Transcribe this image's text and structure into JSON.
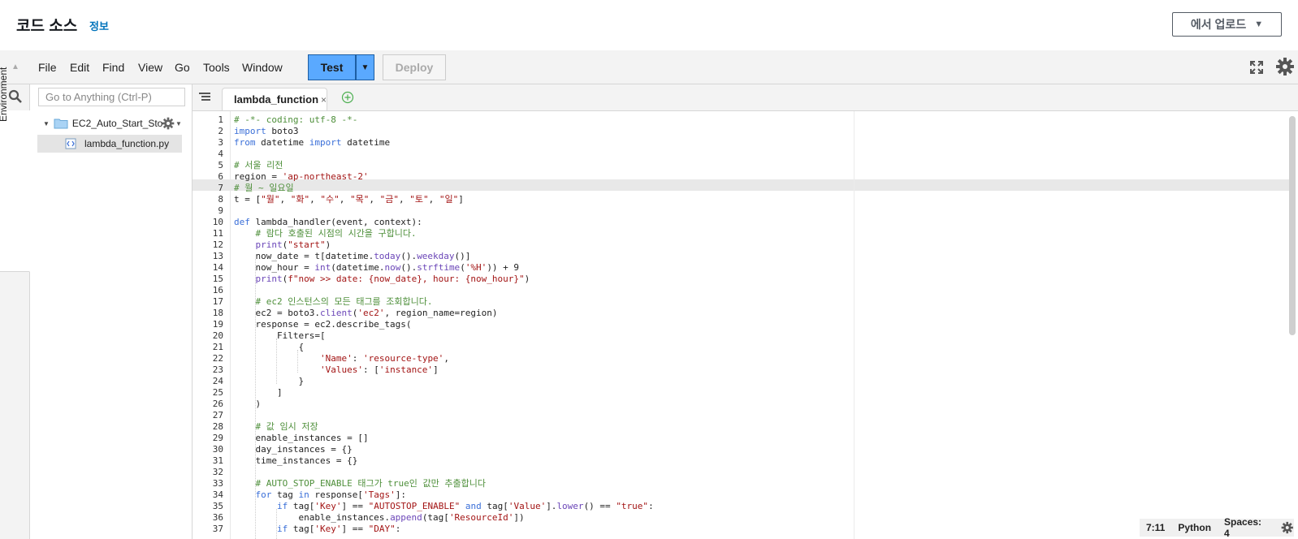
{
  "header": {
    "title": "코드 소스",
    "info_link": "정보",
    "upload_button": "에서 업로드"
  },
  "menu": {
    "items": [
      "File",
      "Edit",
      "Find",
      "View",
      "Go",
      "Tools",
      "Window"
    ],
    "test_label": "Test",
    "deploy_label": "Deploy"
  },
  "sidebar": {
    "environment_label": "Environment",
    "goto_placeholder": "Go to Anything (Ctrl-P)",
    "folder_name": "EC2_Auto_Start_Sto",
    "file_name": "lambda_function.py"
  },
  "editor": {
    "tab_label": "lambda_function",
    "tab_close": "×",
    "lines": [
      "# -*- coding: utf-8 -*-",
      "import boto3",
      "from datetime import datetime",
      "",
      "# 서울 리전",
      "region = 'ap-northeast-2'",
      "# 월 ~ 일요일",
      "t = [\"월\", \"화\", \"수\", \"목\", \"금\", \"토\", \"일\"]",
      "",
      "def lambda_handler(event, context):",
      "    # 람다 호출된 시점의 시간을 구합니다.",
      "    print(\"start\")",
      "    now_date = t[datetime.today().weekday()]",
      "    now_hour = int(datetime.now().strftime('%H')) + 9",
      "    print(f\"now >> date: {now_date}, hour: {now_hour}\")",
      "",
      "    # ec2 인스턴스의 모든 태그를 조회합니다.",
      "    ec2 = boto3.client('ec2', region_name=region)",
      "    response = ec2.describe_tags(",
      "        Filters=[",
      "            {",
      "                'Name': 'resource-type',",
      "                'Values': ['instance']",
      "            }",
      "        ]",
      "    )",
      "",
      "    # 값 임시 저장",
      "    enable_instances = []",
      "    day_instances = {}",
      "    time_instances = {}",
      "",
      "    # AUTO_STOP_ENABLE 태그가 true인 값만 추출합니다",
      "    for tag in response['Tags']:",
      "        if tag['Key'] == \"AUTOSTOP_ENABLE\" and tag['Value'].lower() == \"true\":",
      "            enable_instances.append(tag['ResourceId'])",
      "        if tag['Key'] == \"DAY\":"
    ]
  },
  "status": {
    "position": "7:11",
    "language": "Python",
    "spaces": "Spaces: 4"
  }
}
